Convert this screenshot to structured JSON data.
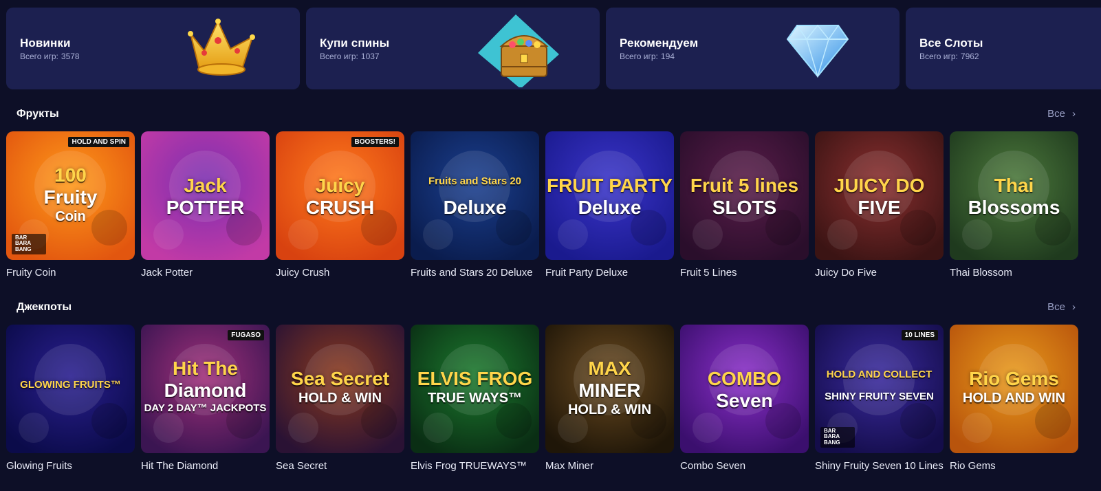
{
  "categories": [
    {
      "title": "Новинки",
      "count_label": "Всего игр:",
      "count": "3578",
      "icon": "crown-icon"
    },
    {
      "title": "Купи спины",
      "count_label": "Всего игр:",
      "count": "1037",
      "icon": "treasure-chest-icon"
    },
    {
      "title": "Рекомендуем",
      "count_label": "Всего игр:",
      "count": "194",
      "icon": "diamond-icon"
    },
    {
      "title": "Все Слоты",
      "count_label": "Всего игр:",
      "count": "7962",
      "icon": ""
    }
  ],
  "sections": [
    {
      "title": "Фрукты",
      "see_all": "Все",
      "games": [
        {
          "name": "Fruity Coin",
          "art": [
            "100",
            "Fruity",
            "Coin"
          ],
          "badge": "HOLD AND SPIN",
          "provider": "BAR BARA BANG",
          "colors": [
            "#ff9a1a",
            "#e2560f"
          ]
        },
        {
          "name": "Jack Potter",
          "art": [
            "Jack",
            "POTTER"
          ],
          "badge": "",
          "provider": "",
          "colors": [
            "#7b2fb0",
            "#c23aa6"
          ]
        },
        {
          "name": "Juicy Crush",
          "art": [
            "Juicy",
            "CRUSH"
          ],
          "badge": "BOOSTERS!",
          "provider": "",
          "colors": [
            "#ff7a1c",
            "#d84210"
          ]
        },
        {
          "name": "Fruits and Stars 20 Deluxe",
          "art": [
            "Fruits and Stars 20",
            "Deluxe"
          ],
          "badge": "",
          "provider": "",
          "colors": [
            "#1b3f8f",
            "#0a1c4d"
          ]
        },
        {
          "name": "Fruit Party Deluxe",
          "art": [
            "FRUIT PARTY",
            "Deluxe"
          ],
          "badge": "",
          "provider": "",
          "colors": [
            "#3a34c9",
            "#1a1a8e"
          ]
        },
        {
          "name": "Fruit 5 Lines",
          "art": [
            "Fruit 5 lines",
            "SLOTS"
          ],
          "badge": "",
          "provider": "",
          "colors": [
            "#5a1d4a",
            "#2a0e2b"
          ]
        },
        {
          "name": "Juicy Do Five",
          "art": [
            "JUICY DO",
            "FIVE"
          ],
          "badge": "",
          "provider": "",
          "colors": [
            "#8a2f2f",
            "#3b1414"
          ]
        },
        {
          "name": "Thai Blossom",
          "art": [
            "Thai",
            "Blossoms"
          ],
          "badge": "",
          "provider": "",
          "colors": [
            "#4d7a3c",
            "#1f3a1e"
          ]
        }
      ]
    },
    {
      "title": "Джекпоты",
      "see_all": "Все",
      "games": [
        {
          "name": "Glowing Fruits",
          "art": [
            "GLOWING FRUITS™"
          ],
          "badge": "",
          "provider": "",
          "colors": [
            "#2a1f8f",
            "#0b0b4a"
          ]
        },
        {
          "name": "Hit The Diamond",
          "art": [
            "Hit The",
            "Diamond",
            "DAY 2 DAY™ JACKPOTS"
          ],
          "badge": "FUGASO",
          "provider": "",
          "colors": [
            "#a0307a",
            "#3b1552"
          ]
        },
        {
          "name": "Sea Secret",
          "art": [
            "Sea Secret",
            "HOLD & WIN"
          ],
          "badge": "",
          "provider": "",
          "colors": [
            "#8a3a1e",
            "#2a1234"
          ]
        },
        {
          "name": "Elvis Frog TRUEWAYS™",
          "art": [
            "ELVIS FROG",
            "TRUE WAYS™"
          ],
          "badge": "",
          "provider": "",
          "colors": [
            "#1c7a2e",
            "#0a2e14"
          ]
        },
        {
          "name": "Max Miner",
          "art": [
            "MAX",
            "MINER",
            "HOLD & WIN"
          ],
          "badge": "",
          "provider": "",
          "colors": [
            "#6a4a20",
            "#1f1608"
          ]
        },
        {
          "name": "Combo Seven",
          "art": [
            "COMBO",
            "Seven"
          ],
          "badge": "",
          "provider": "",
          "colors": [
            "#8a2fc8",
            "#3b0f6e"
          ]
        },
        {
          "name": "Shiny Fruity Seven 10 Lines",
          "art": [
            "HOLD AND COLLECT",
            "SHINY FRUITY SEVEN"
          ],
          "badge": "10 LINES",
          "provider": "BAR BARA BANG",
          "colors": [
            "#3a2a9e",
            "#140d4a"
          ]
        },
        {
          "name": "Rio Gems",
          "art": [
            "Rio Gems",
            "HOLD AND WIN"
          ],
          "badge": "",
          "provider": "",
          "colors": [
            "#e89a1c",
            "#b8540c"
          ]
        }
      ]
    }
  ]
}
